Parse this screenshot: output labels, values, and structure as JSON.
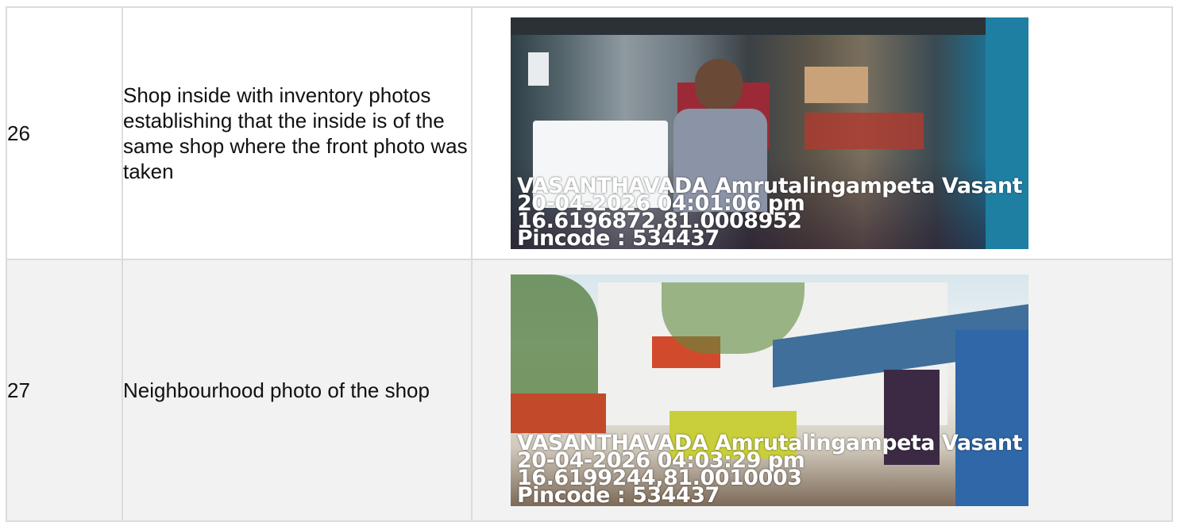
{
  "rows": [
    {
      "number": "26",
      "description": "Shop inside with inventory photos establishing that the inside is of the same shop where the front photo was taken",
      "photo": {
        "caption_line1": "VASANTHAVADA Amrutalingampeta Vasant",
        "caption_line2": "20-04-2026 04:01:06 pm",
        "caption_line3": "16.6196872,81.0008952",
        "caption_line4": "Pincode : 534437"
      }
    },
    {
      "number": "27",
      "description": "Neighbourhood photo of the shop",
      "photo": {
        "caption_line1": "VASANTHAVADA Amrutalingampeta Vasant",
        "caption_line2": "20-04-2026 04:03:29 pm",
        "caption_line3": "16.6199244,81.0010003",
        "caption_line4": "Pincode : 534437"
      }
    }
  ],
  "colors": {
    "border": "#dcdcdc",
    "row_alt_bg": "#f2f2f2",
    "overlay_text": "#ffffff"
  }
}
